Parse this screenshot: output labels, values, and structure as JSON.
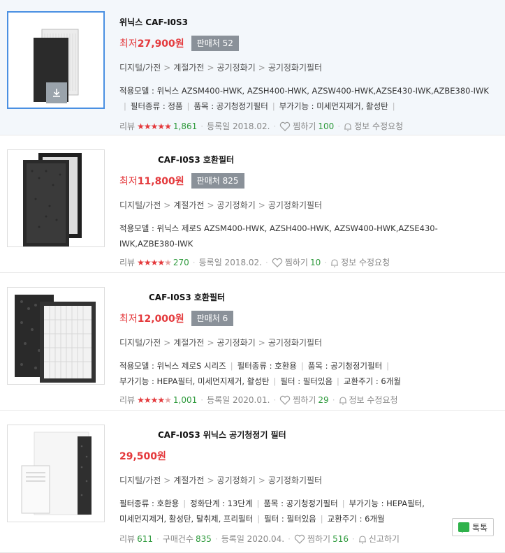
{
  "products": [
    {
      "title": "위닉스 CAF-I0S3",
      "price_label": "최저",
      "price": "27,900원",
      "seller_label": "판매처 52",
      "breadcrumb": [
        "디지털/가전",
        "계절가전",
        "공기정화기",
        "공기정화기필터"
      ],
      "spec_line1": "적용모델 : 위닉스 AZSM400-HWK, AZSH400-HWK, AZSW400-HWK,AZSE430-IWK,AZBE380-IWK",
      "spec_line2": [
        "필터종류 : 정품",
        "품목 : 공기청정기필터",
        "부가기능 : 미세먼지제거, 활성탄"
      ],
      "review_label": "리뷰",
      "rating_stars": 5,
      "review_count": "1,861",
      "registered": "등록일 2018.02.",
      "wish_label": "찜하기",
      "wish_count": "100",
      "action_label": "정보 수정요청"
    },
    {
      "title": "CAF-I0S3 호환필터",
      "price_label": "최저",
      "price": "11,800원",
      "seller_label": "판매처 825",
      "breadcrumb": [
        "디지털/가전",
        "계절가전",
        "공기정화기",
        "공기정화기필터"
      ],
      "spec_line1": "적용모델 : 위닉스 제로S AZSM400-HWK, AZSH400-HWK, AZSW400-HWK,AZSE430-",
      "spec_line1b": "IWK,AZBE380-IWK",
      "review_label": "리뷰",
      "rating_stars": 4.5,
      "review_count": "270",
      "registered": "등록일 2018.02.",
      "wish_label": "찜하기",
      "wish_count": "10",
      "action_label": "정보 수정요청"
    },
    {
      "title": "CAF-I0S3 호환필터",
      "price_label": "최저",
      "price": "12,000원",
      "seller_label": "판매처 6",
      "breadcrumb": [
        "디지털/가전",
        "계절가전",
        "공기정화기",
        "공기정화기필터"
      ],
      "spec_line1_parts": [
        "적용모델 : 위닉스 제로S 시리즈",
        "필터종류 : 호환용",
        "품목 : 공기청정기필터"
      ],
      "spec_line2": [
        "부가기능 : HEPA필터, 미세먼지제거, 활성탄",
        "필터 : 필터있음",
        "교환주기 : 6개월"
      ],
      "review_label": "리뷰",
      "rating_stars": 4.5,
      "review_count": "1,001",
      "registered": "등록일 2020.01.",
      "wish_label": "찜하기",
      "wish_count": "29",
      "action_label": "정보 수정요청"
    },
    {
      "title": "CAF-I0S3 위닉스 공기청정기 필터",
      "price": "29,500원",
      "breadcrumb": [
        "디지털/가전",
        "계절가전",
        "공기정화기",
        "공기정화기필터"
      ],
      "spec_line1_parts": [
        "필터종류 : 호환용",
        "정화단계 : 13단계",
        "품목 : 공기청정기필터",
        "부가기능 : HEPA필터,"
      ],
      "spec_line2": [
        "미세먼지제거, 활성탄, 탈취제, 프리필터",
        "필터 : 필터있음",
        "교환주기 : 6개월"
      ],
      "review_label": "리뷰",
      "review_count": "611",
      "purchase_label": "구매건수",
      "purchase_count": "835",
      "registered": "등록일 2020.04.",
      "wish_label": "찜하기",
      "wish_count": "516",
      "action_label": "신고하기"
    }
  ],
  "talk_button_label": "톡톡",
  "colors": {
    "price_red": "#e4393c",
    "count_green": "#2e9a3c",
    "seller_gray": "#8a9199",
    "highlight_bg": "#f3f7fb",
    "talk_green": "#2fb24b"
  },
  "icons": [
    "download-icon",
    "star-icon",
    "heart-icon",
    "bell-icon",
    "talk-icon"
  ]
}
